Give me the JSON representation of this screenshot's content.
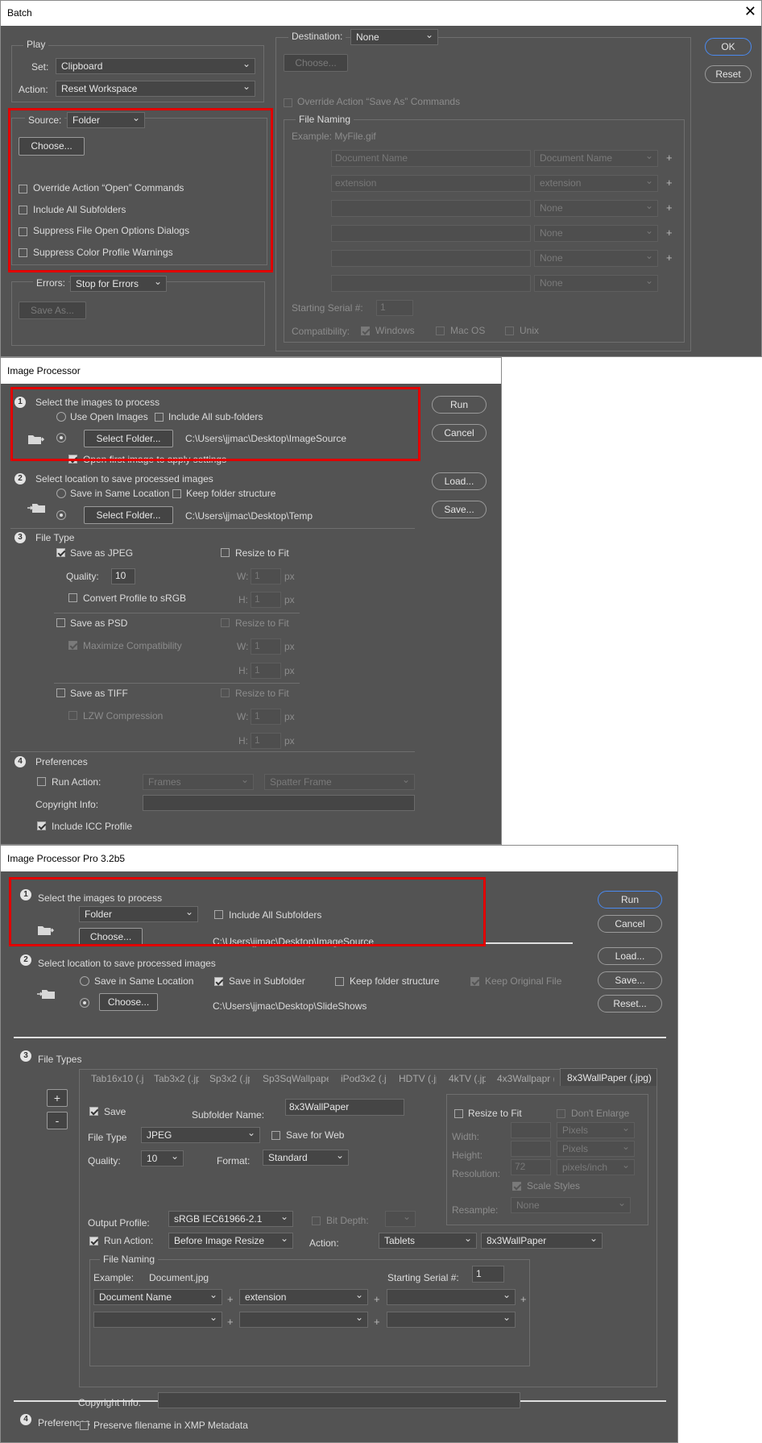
{
  "batch": {
    "title": "Batch",
    "close_glyph": "✕",
    "play": {
      "legend": "Play",
      "set_label": "Set:",
      "set_value": "Clipboard",
      "action_label": "Action:",
      "action_value": "Reset Workspace"
    },
    "source": {
      "label": "Source:",
      "value": "Folder",
      "choose": "Choose...",
      "checks": [
        "Override Action “Open” Commands",
        "Include All Subfolders",
        "Suppress File Open Options Dialogs",
        "Suppress Color Profile Warnings"
      ]
    },
    "errors": {
      "label": "Errors:",
      "value": "Stop for Errors",
      "save_as": "Save As..."
    },
    "destination": {
      "label": "Destination:",
      "value": "None",
      "choose": "Choose...",
      "override": "Override Action “Save As” Commands"
    },
    "file_naming": {
      "legend": "File Naming",
      "example": "Example: MyFile.gif",
      "rows": [
        {
          "text": "Document Name",
          "select": "Document Name"
        },
        {
          "text": "extension",
          "select": "extension"
        },
        {
          "text": "",
          "select": "None"
        },
        {
          "text": "",
          "select": "None"
        },
        {
          "text": "",
          "select": "None"
        },
        {
          "text": "",
          "select": "None"
        }
      ],
      "plus": "+",
      "serial_label": "Starting Serial #:",
      "serial_value": "1",
      "compat_label": "Compatibility:",
      "compat": [
        "Windows",
        "Mac OS",
        "Unix"
      ]
    },
    "ok": "OK",
    "reset": "Reset"
  },
  "ip": {
    "title": "Image Processor",
    "s1": {
      "num": "1",
      "title": "Select the images to process",
      "use_open": "Use Open Images",
      "include_sub": "Include All sub-folders",
      "select_folder": "Select Folder...",
      "path": "C:\\Users\\jjmac\\Desktop\\ImageSource",
      "open_first": "Open first image to apply settings"
    },
    "s2": {
      "num": "2",
      "title": "Select location to save processed images",
      "same": "Save in Same Location",
      "keep": "Keep folder structure",
      "select_folder": "Select Folder...",
      "path": "C:\\Users\\jjmac\\Desktop\\Temp"
    },
    "s3": {
      "num": "3",
      "title": "File Type",
      "jpeg": "Save as JPEG",
      "resize": "Resize to Fit",
      "quality_label": "Quality:",
      "quality": "10",
      "w": "W:",
      "h": "H:",
      "px": "px",
      "wh_value": "1",
      "convert": "Convert Profile to sRGB",
      "psd": "Save as PSD",
      "maximize": "Maximize Compatibility",
      "tiff": "Save as TIFF",
      "lzw": "LZW Compression"
    },
    "s4": {
      "num": "4",
      "title": "Preferences",
      "run_action": "Run Action:",
      "set": "Frames",
      "action": "Spatter Frame",
      "copyright": "Copyright Info:",
      "icc": "Include ICC Profile"
    },
    "run": "Run",
    "cancel": "Cancel",
    "load": "Load...",
    "save": "Save..."
  },
  "ipp": {
    "title": "Image Processor Pro 3.2b5",
    "s1": {
      "num": "1",
      "title": "Select the images to process",
      "source": "Folder",
      "include_sub": "Include All Subfolders",
      "choose": "Choose...",
      "path": "C:\\Users\\jjmac\\Desktop\\ImageSource"
    },
    "s2": {
      "num": "2",
      "title": "Select location to save processed images",
      "same": "Save in Same Location",
      "subfolder": "Save in Subfolder",
      "keep": "Keep folder structure",
      "keep_orig": "Keep Original File",
      "choose": "Choose...",
      "path": "C:\\Users\\jjmac\\Desktop\\SlideShows"
    },
    "s3": {
      "num": "3",
      "title": "File Types",
      "tabs": [
        "Tab16x10 (.j",
        "Tab3x2 (.jp",
        "Sp3x2 (.jp",
        "Sp3SqWallpaper (",
        "iPod3x2 (.jp",
        "HDTV (.jp",
        "4kTV (.jpg",
        "4x3Wallpapr (.",
        "8x3WallPaper (.jpg)"
      ],
      "add": "+",
      "remove": "-",
      "save": "Save",
      "subfolder_label": "Subfolder Name:",
      "subfolder": "8x3WallPaper",
      "file_type_label": "File Type",
      "file_type": "JPEG",
      "save_web": "Save for Web",
      "quality_label": "Quality:",
      "quality": "10",
      "format_label": "Format:",
      "format": "Standard",
      "resize": "Resize to Fit",
      "dont_enlarge": "Don't Enlarge",
      "width": "Width:",
      "height": "Height:",
      "resolution": "Resolution:",
      "pixels": "Pixels",
      "res_value": "72",
      "res_unit": "pixels/inch",
      "scale_styles": "Scale Styles",
      "resample": "Resample:",
      "resample_value": "None",
      "output_profile_label": "Output Profile:",
      "output_profile": "sRGB IEC61966-2.1",
      "bit_depth": "Bit Depth:",
      "run_action": "Run Action:",
      "run_when": "Before Image Resize",
      "action_label": "Action:",
      "action_set": "Tablets",
      "action": "8x3WallPaper",
      "naming": {
        "legend": "File Naming",
        "example_label": "Example:",
        "example": "Document.jpg",
        "serial_label": "Starting Serial #:",
        "serial": "1",
        "r1": [
          "Document Name",
          "extension",
          ""
        ],
        "r2": [
          "",
          "",
          ""
        ],
        "plus": "+"
      }
    },
    "s4": {
      "num": "4",
      "title": "Preferences",
      "copyright": "Copyright Info:",
      "preserve": "Preserve filename in XMP Metadata"
    },
    "run": "Run",
    "cancel": "Cancel",
    "load": "Load...",
    "save": "Save...",
    "reset": "Reset..."
  }
}
